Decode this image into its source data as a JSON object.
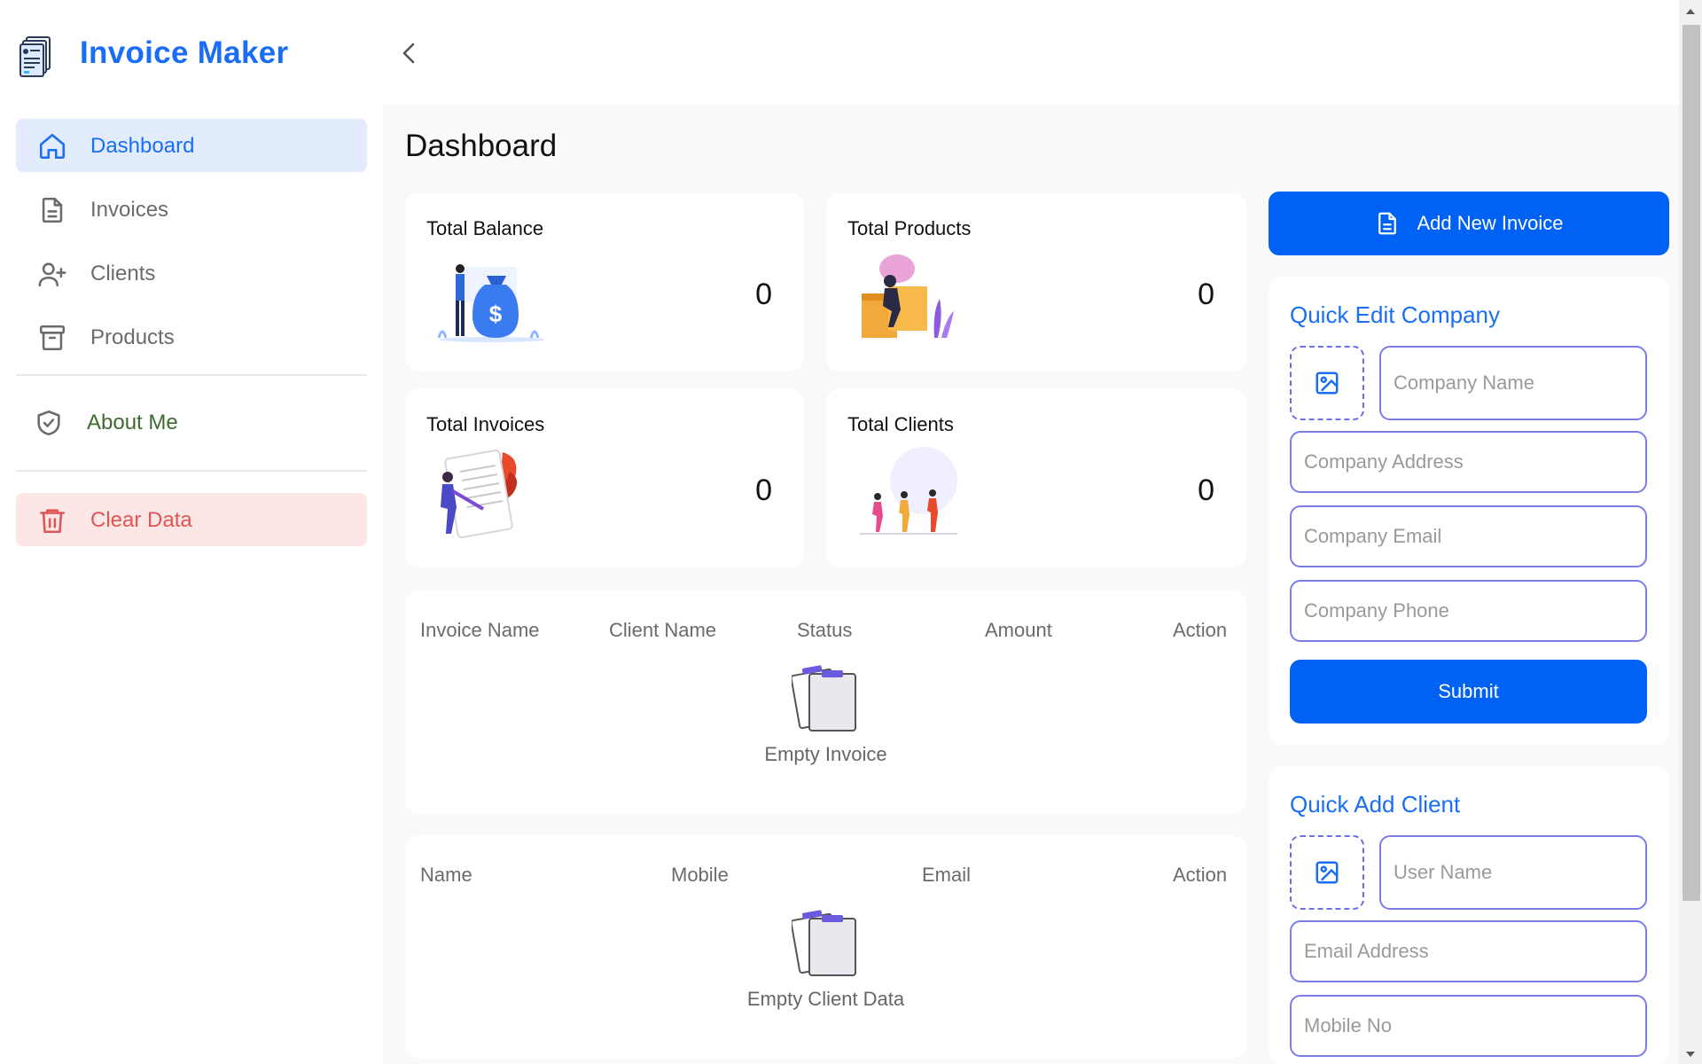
{
  "brand": {
    "title": "Invoice Maker",
    "logo_icon": "invoice-stack-icon",
    "color": "#1a6ef5"
  },
  "sidebar": {
    "items": [
      {
        "label": "Dashboard",
        "icon": "home-icon",
        "active": true
      },
      {
        "label": "Invoices",
        "icon": "document-icon"
      },
      {
        "label": "Clients",
        "icon": "user-plus-icon"
      },
      {
        "label": "Products",
        "icon": "archive-box-icon"
      },
      {
        "label": "About Me",
        "icon": "shield-check-icon"
      },
      {
        "label": "Clear Data",
        "icon": "trash-icon"
      }
    ]
  },
  "header": {
    "collapse_icon": "chevron-left-icon"
  },
  "main": {
    "title": "Dashboard",
    "stats": [
      {
        "title": "Total Balance",
        "value": "0"
      },
      {
        "title": "Total Products",
        "value": "0"
      },
      {
        "title": "Total Invoices",
        "value": "0"
      },
      {
        "title": "Total Clients",
        "value": "0"
      }
    ],
    "invoice_table": {
      "headers": [
        "Invoice Name",
        "Client Name",
        "Status",
        "Amount",
        "Action"
      ],
      "empty_text": "Empty Invoice"
    },
    "client_table": {
      "headers": [
        "Name",
        "Mobile",
        "Email",
        "Action"
      ],
      "empty_text": "Empty Client Data"
    }
  },
  "right": {
    "add_invoice_label": "Add New Invoice",
    "quick_edit_company": {
      "title": "Quick Edit Company",
      "company_name_placeholder": "Company Name",
      "company_address_placeholder": "Company Address",
      "company_email_placeholder": "Company Email",
      "company_phone_placeholder": "Company Phone",
      "submit_label": "Submit"
    },
    "quick_add_client": {
      "title": "Quick Add Client",
      "user_name_placeholder": "User Name",
      "email_placeholder": "Email Address",
      "mobile_placeholder": "Mobile No"
    }
  },
  "colors": {
    "primary": "#0062f5",
    "accent": "#1a6ef5",
    "danger": "#e25555",
    "input_border": "#7c7ce8"
  }
}
